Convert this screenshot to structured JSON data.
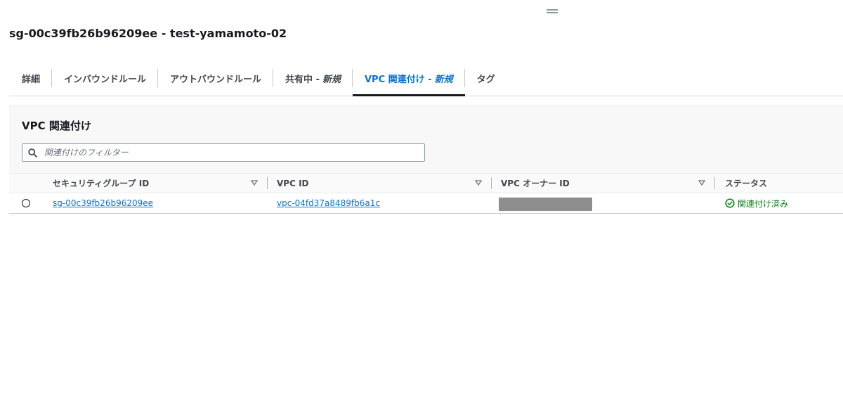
{
  "header": {
    "title": "sg-00c39fb26b96209ee - test-yamamoto-02"
  },
  "tabs": [
    {
      "label": "詳細",
      "suffix": ""
    },
    {
      "label": "インバウンドルール",
      "suffix": ""
    },
    {
      "label": "アウトバウンドルール",
      "suffix": ""
    },
    {
      "label": "共有中 -",
      "suffix": "新規"
    },
    {
      "label": "VPC 関連付け -",
      "suffix": "新規"
    },
    {
      "label": "タグ",
      "suffix": ""
    }
  ],
  "active_tab": "VPC 関連付け -",
  "section": {
    "title": "VPC 関連付け",
    "filter_placeholder": "関連付けのフィルター"
  },
  "table": {
    "columns": [
      "セキュリティグループ ID",
      "VPC ID",
      "VPC オーナー ID",
      "ステータス"
    ],
    "rows": [
      {
        "sg_id": "sg-00c39fb26b96209ee",
        "vpc_id": "vpc-04fd37a8489fb6a1c",
        "owner_id": "",
        "status": "関連付け済み"
      }
    ]
  },
  "colors": {
    "link": "#0972d3",
    "success": "#037f0c",
    "text": "#16191f"
  },
  "icons": [
    "search-icon",
    "sort-icon",
    "success-icon",
    "drag-handle-icon"
  ]
}
